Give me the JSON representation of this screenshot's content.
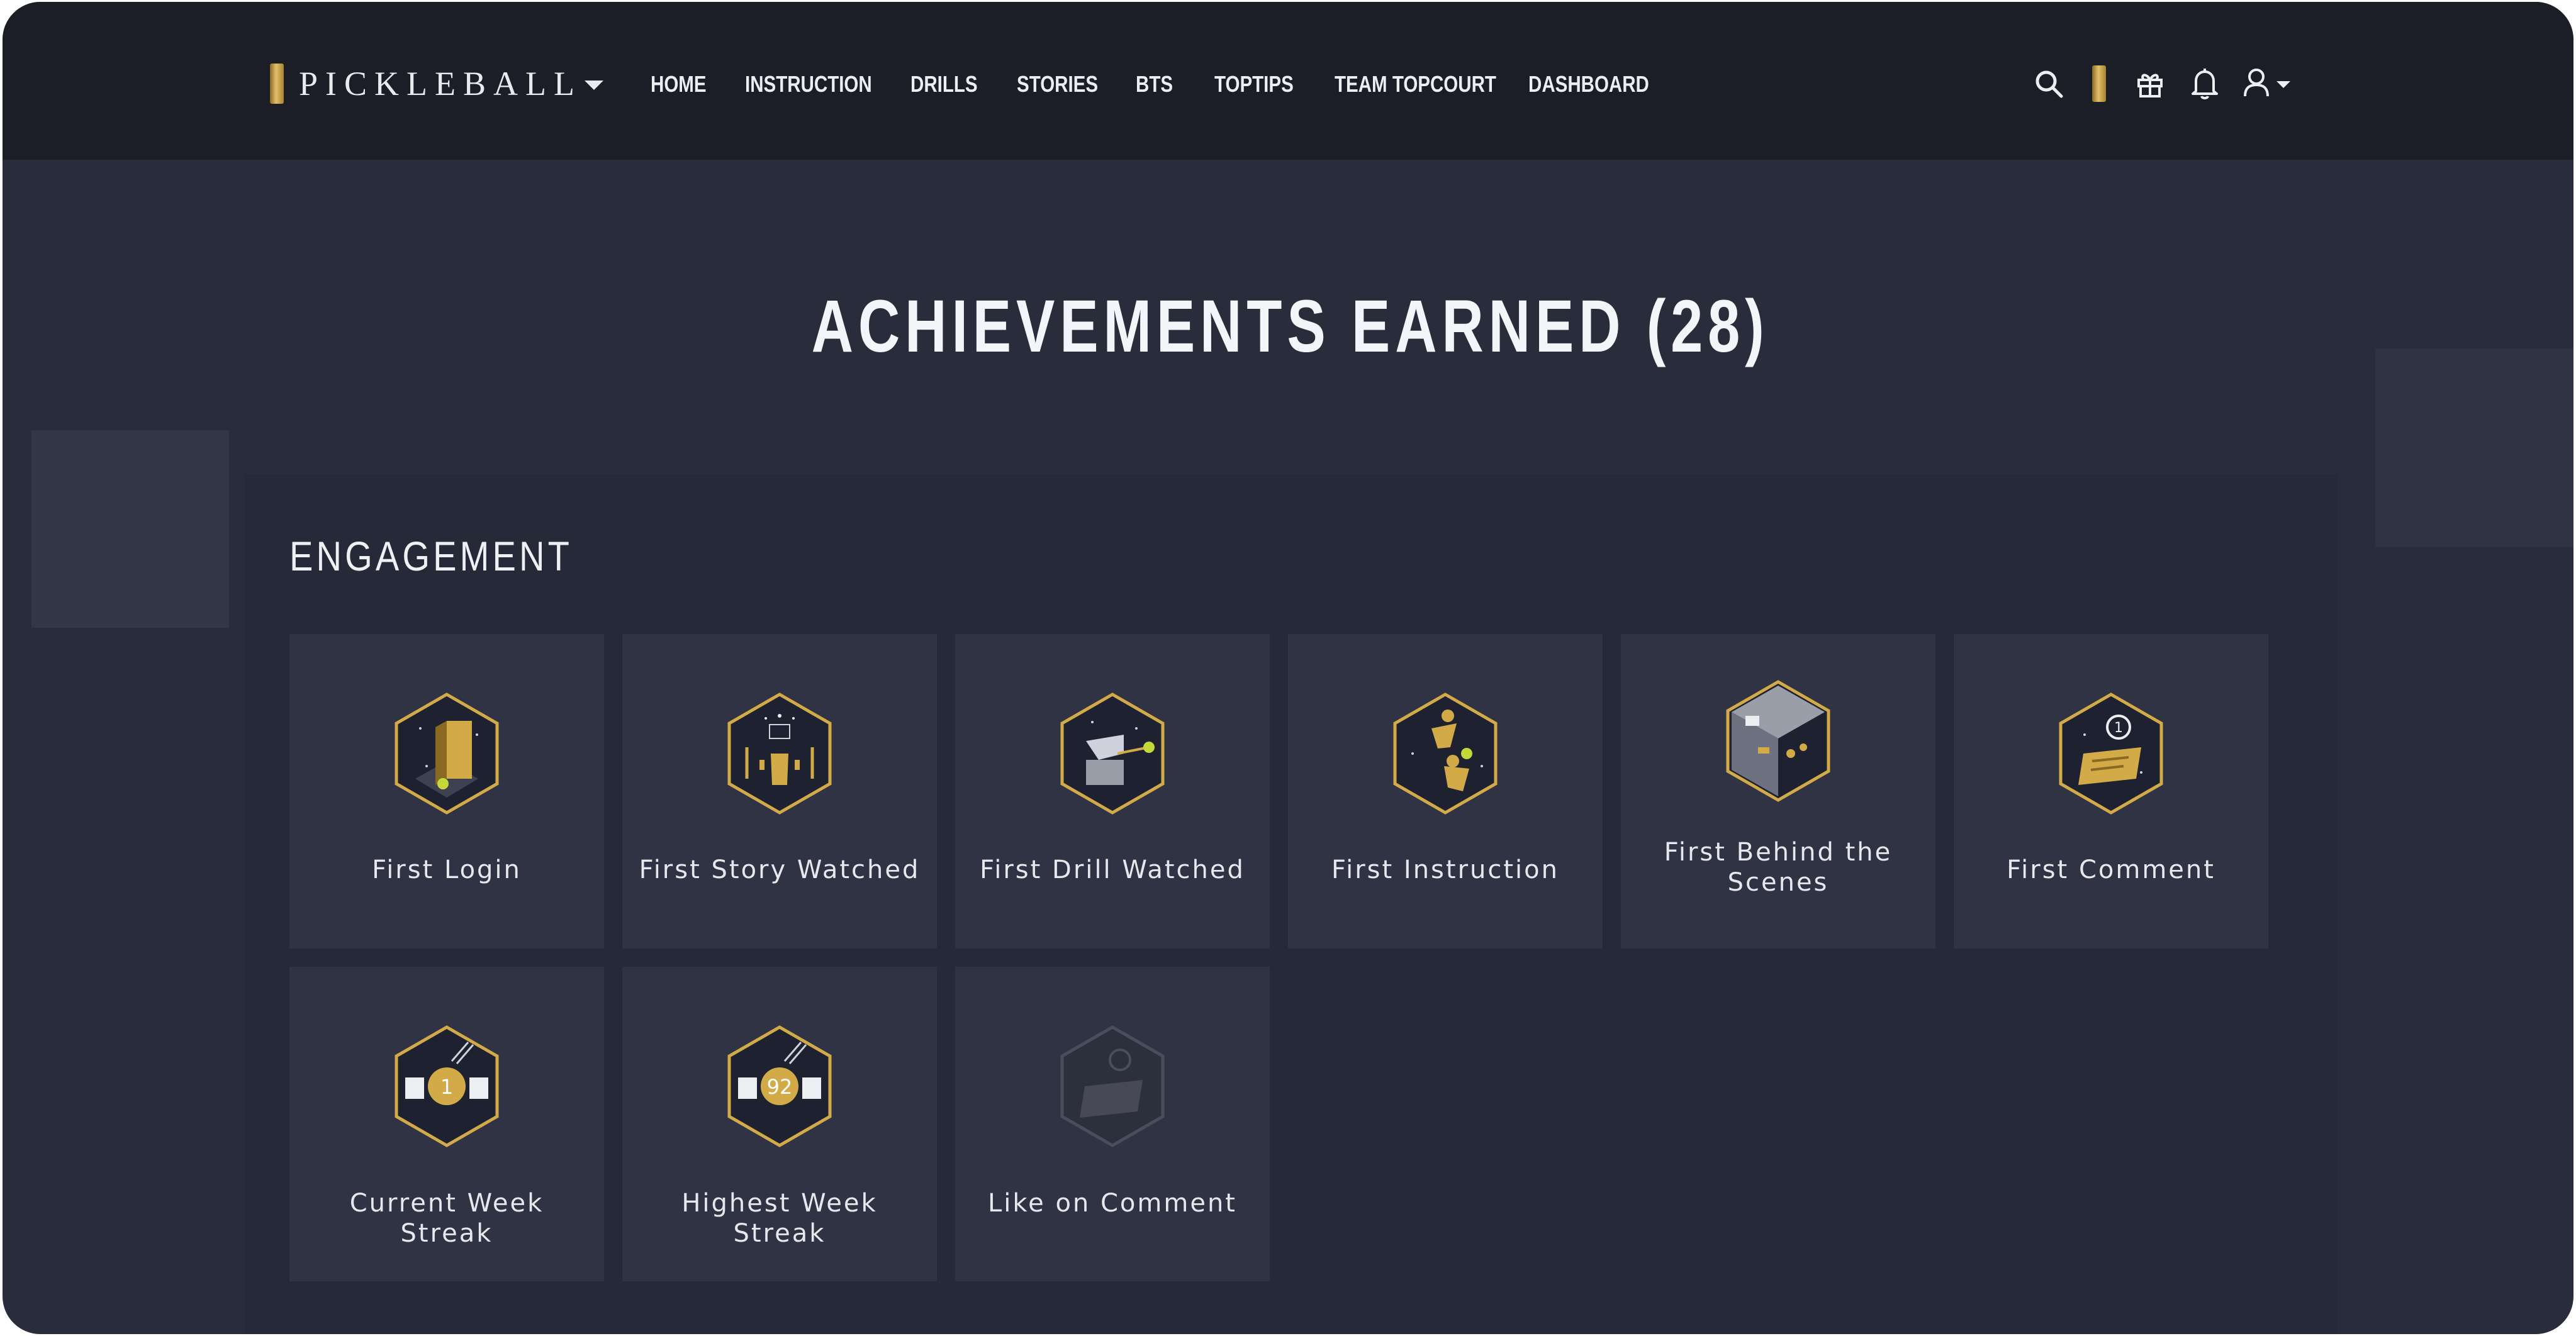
{
  "nav": {
    "logo_text": "PICKLEBALL",
    "links": [
      "HOME",
      "INSTRUCTION",
      "DRILLS",
      "STORIES",
      "BTS",
      "TOPTIPS",
      "TEAM TOPCOURT",
      "DASHBOARD"
    ]
  },
  "page": {
    "title": "ACHIEVEMENTS EARNED (28)"
  },
  "section": {
    "title": "ENGAGEMENT",
    "achievements": [
      {
        "label": "First Login",
        "icon": "first-login-badge-icon",
        "earned": true
      },
      {
        "label": "First Story Watched",
        "icon": "first-story-badge-icon",
        "earned": true
      },
      {
        "label": "First Drill Watched",
        "icon": "first-drill-badge-icon",
        "earned": true
      },
      {
        "label": "First Instruction",
        "icon": "first-instruction-badge-icon",
        "earned": true
      },
      {
        "label": "First Behind the Scenes",
        "icon": "first-bts-badge-icon",
        "earned": true
      },
      {
        "label": "First Comment",
        "icon": "first-comment-badge-icon",
        "earned": true
      },
      {
        "label": "Current Week Streak",
        "icon": "current-streak-badge-icon",
        "earned": true,
        "value": "1"
      },
      {
        "label": "Highest Week Streak",
        "icon": "highest-streak-badge-icon",
        "earned": true,
        "value": "92"
      },
      {
        "label": "Like on Comment",
        "icon": "like-comment-badge-icon",
        "earned": false
      }
    ]
  },
  "colors": {
    "page_bg": "#292c3a",
    "nav_bg": "#1b1e27",
    "card_bg": "#303343",
    "gold": "#d2aa48"
  }
}
